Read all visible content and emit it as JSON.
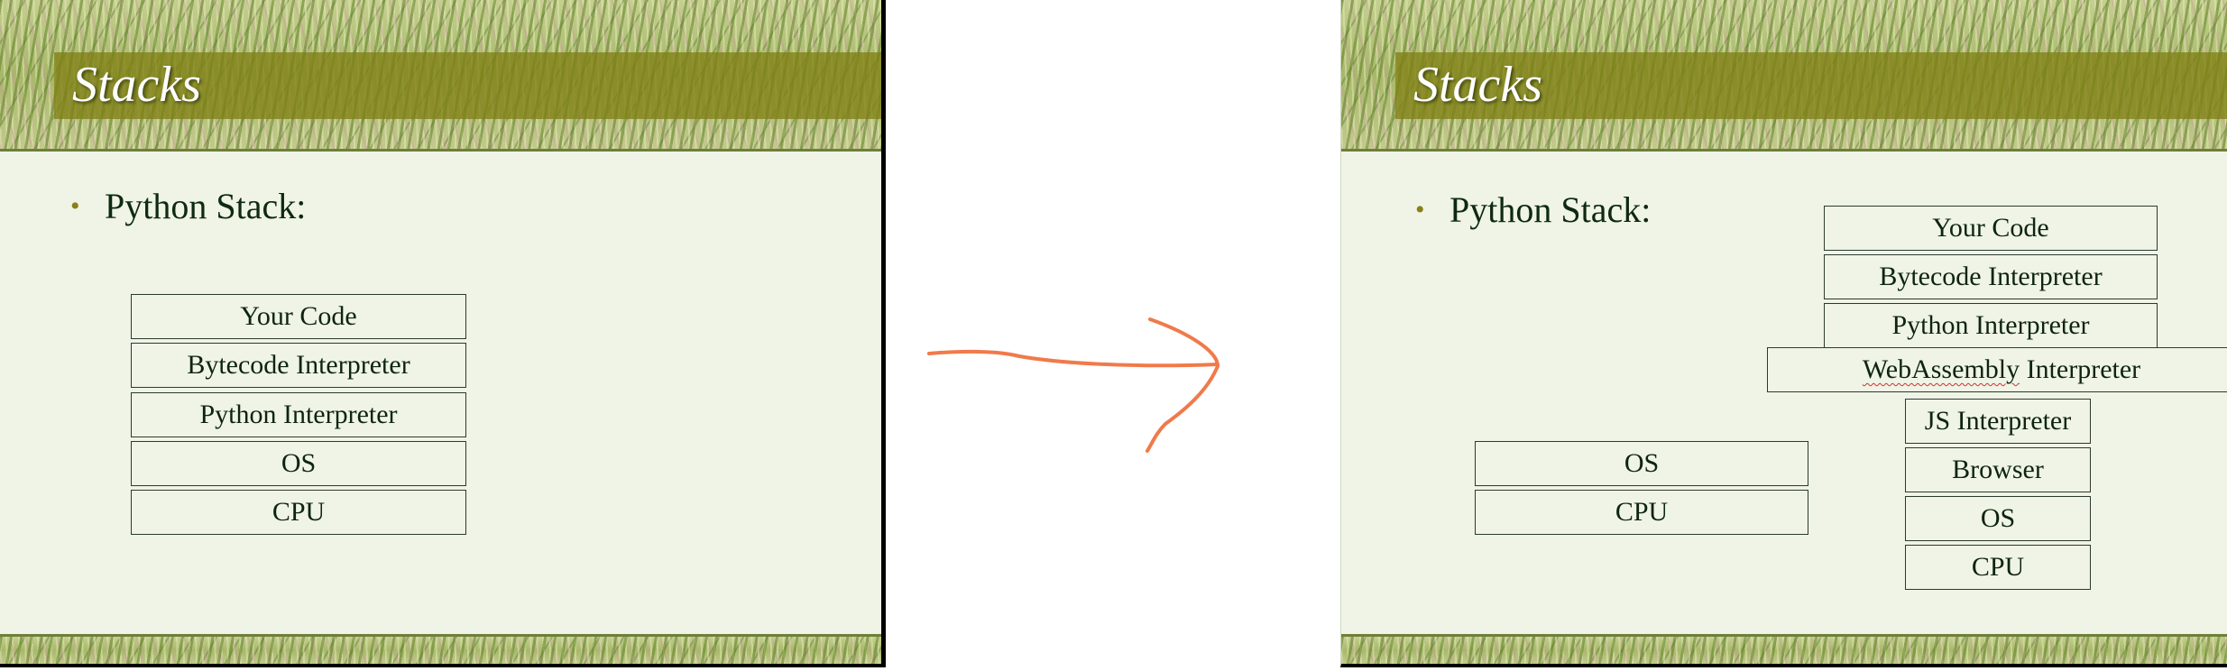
{
  "left_slide": {
    "title": "Stacks",
    "bullet": "Python Stack:",
    "stack": [
      "Your Code",
      "Bytecode Interpreter",
      "Python Interpreter",
      "OS",
      "CPU"
    ]
  },
  "right_slide": {
    "title": "Stacks",
    "bullet": "Python Stack:",
    "native_stack": [
      "OS",
      "CPU"
    ],
    "wasm_stack": {
      "top": [
        "Your Code",
        "Bytecode Interpreter",
        "Python Interpreter"
      ],
      "wasm_word": "WebAssembly",
      "wasm_rest": " Interpreter",
      "bottom": [
        "JS Interpreter",
        "Browser",
        "OS",
        "CPU"
      ]
    }
  },
  "arrow": {
    "icon": "hand-drawn-arrow-icon",
    "color": "#f07a4a"
  }
}
